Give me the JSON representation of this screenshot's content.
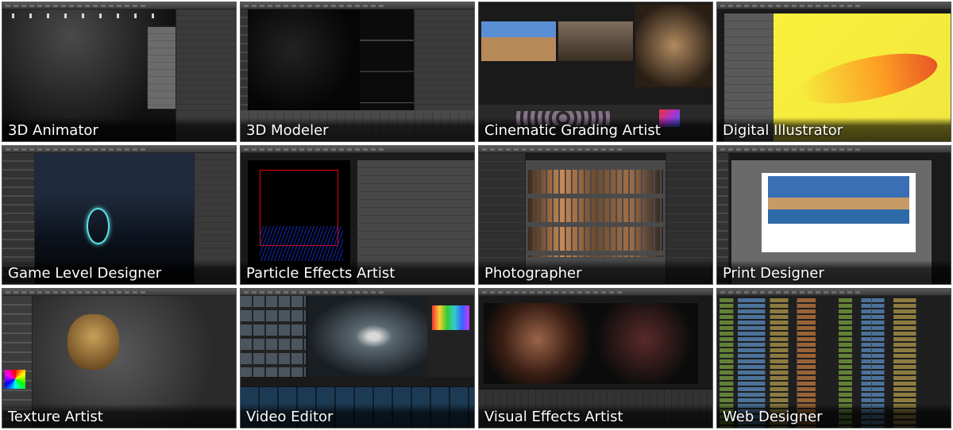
{
  "tiles": [
    {
      "id": "3d-animator",
      "caption": "3D Animator"
    },
    {
      "id": "3d-modeler",
      "caption": "3D Modeler"
    },
    {
      "id": "cinematic-grading-artist",
      "caption": "Cinematic Grading Artist"
    },
    {
      "id": "digital-illustrator",
      "caption": "Digital Illustrator"
    },
    {
      "id": "game-level-designer",
      "caption": "Game Level Designer"
    },
    {
      "id": "particle-effects-artist",
      "caption": "Particle Effects Artist"
    },
    {
      "id": "photographer",
      "caption": "Photographer"
    },
    {
      "id": "print-designer",
      "caption": "Print Designer"
    },
    {
      "id": "texture-artist",
      "caption": "Texture Artist"
    },
    {
      "id": "video-editor",
      "caption": "Video Editor"
    },
    {
      "id": "visual-effects-artist",
      "caption": "Visual Effects Artist"
    },
    {
      "id": "web-designer",
      "caption": "Web Designer"
    }
  ],
  "colors": {
    "caption_text": "#ffffff",
    "tile_border": "#555555",
    "background": "#ffffff"
  }
}
